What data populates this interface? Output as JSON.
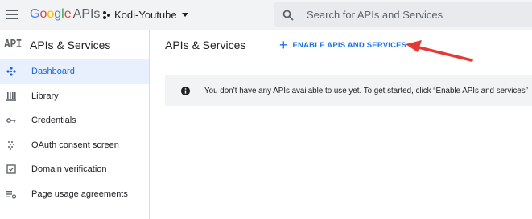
{
  "header": {
    "brand_google": [
      "G",
      "o",
      "o",
      "g",
      "l",
      "e"
    ],
    "brand_suffix": "APIs",
    "project_name": "Kodi-Youtube",
    "search_placeholder": "Search for APIs and Services"
  },
  "sidebar": {
    "logo_text": "API",
    "title": "APIs & Services",
    "items": [
      {
        "label": "Dashboard",
        "icon": "dashboard-icon",
        "active": true
      },
      {
        "label": "Library",
        "icon": "library-icon",
        "active": false
      },
      {
        "label": "Credentials",
        "icon": "key-icon",
        "active": false
      },
      {
        "label": "OAuth consent screen",
        "icon": "consent-icon",
        "active": false
      },
      {
        "label": "Domain verification",
        "icon": "checkbox-icon",
        "active": false
      },
      {
        "label": "Page usage agreements",
        "icon": "settings-list-icon",
        "active": false
      }
    ]
  },
  "main": {
    "title": "APIs & Services",
    "enable_button": "ENABLE APIS AND SERVICES",
    "banner_text": "You don’t have any APIs available to use yet. To get started, click “Enable APIs and services”"
  },
  "colors": {
    "accent": "#1a73e8",
    "active_bg": "#e8f0fe",
    "annotation_arrow": "#e53935"
  }
}
